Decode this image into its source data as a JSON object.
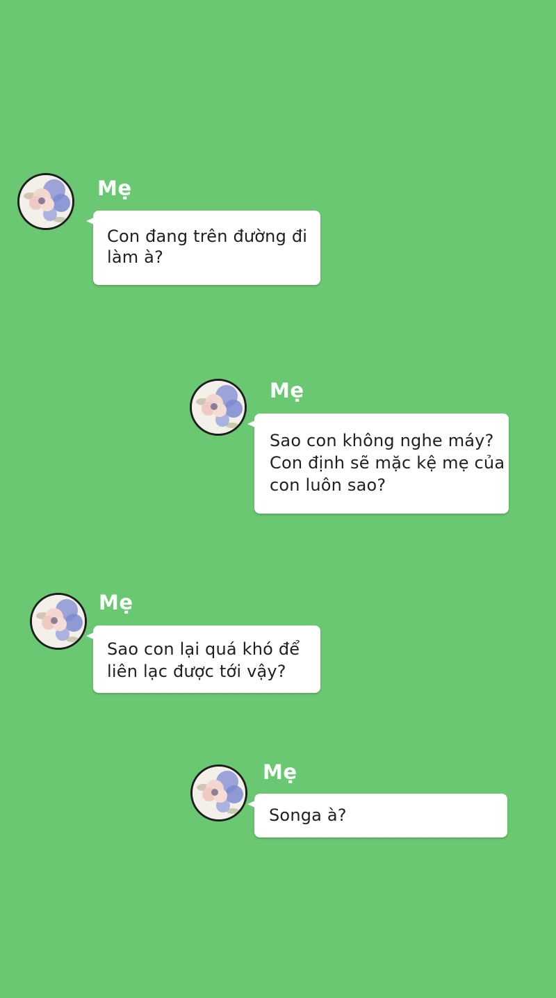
{
  "conversation": {
    "messages": [
      {
        "sender": "Mẹ",
        "avatar_icon": "flower-avatar-icon",
        "lines": [
          "Con đang trên đường đi",
          "làm à?"
        ]
      },
      {
        "sender": "Mẹ",
        "avatar_icon": "flower-avatar-icon",
        "lines": [
          "Sao con không nghe máy?",
          "Con định sẽ mặc kệ mẹ của",
          "con luôn sao?"
        ]
      },
      {
        "sender": "Mẹ",
        "avatar_icon": "flower-avatar-icon",
        "lines": [
          "Sao con lại quá khó để",
          "liên lạc được tới vậy?"
        ]
      },
      {
        "sender": "Mẹ",
        "avatar_icon": "flower-avatar-icon",
        "lines": [
          "Songa à?"
        ]
      }
    ]
  },
  "colors": {
    "background": "#6ac872",
    "bubble": "#ffffff",
    "sender_text": "#ffffff",
    "message_text": "#1f1f1f"
  }
}
